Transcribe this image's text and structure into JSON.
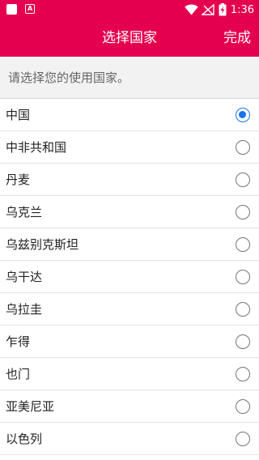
{
  "status_bar": {
    "time": "1:36",
    "left_icons": [
      "notification-square-icon",
      "app-a-icon"
    ],
    "right_icons": [
      "wifi-icon",
      "no-signal-icon",
      "battery-charging-icon"
    ]
  },
  "app_bar": {
    "title": "选择国家",
    "done_label": "完成",
    "color": "#e5004f"
  },
  "hint": {
    "text": "请选择您的使用国家。"
  },
  "radio_colors": {
    "checked": "#1a73e8",
    "unchecked": "#757575"
  },
  "countries": [
    {
      "label": "中国",
      "selected": true
    },
    {
      "label": "中非共和国",
      "selected": false
    },
    {
      "label": "丹麦",
      "selected": false
    },
    {
      "label": "乌克兰",
      "selected": false
    },
    {
      "label": "乌兹别克斯坦",
      "selected": false
    },
    {
      "label": "乌干达",
      "selected": false
    },
    {
      "label": "乌拉圭",
      "selected": false
    },
    {
      "label": "乍得",
      "selected": false
    },
    {
      "label": "也门",
      "selected": false
    },
    {
      "label": "亚美尼亚",
      "selected": false
    },
    {
      "label": "以色列",
      "selected": false
    }
  ]
}
